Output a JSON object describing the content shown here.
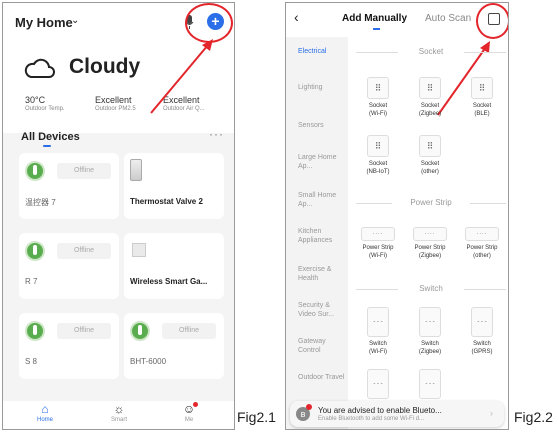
{
  "left_phone": {
    "home_title": "My Home",
    "weather": "Cloudy",
    "stats": [
      {
        "value": "30°C",
        "label": "Outdoor Temp."
      },
      {
        "value": "Excellent",
        "label": "Outdoor PM2.5"
      },
      {
        "value": "Excellent",
        "label": "Outdoor Air Q..."
      }
    ],
    "all_devices": "All Devices",
    "devices": [
      {
        "name": "温控器 7",
        "status": "Offline"
      },
      {
        "name": "Thermostat Valve 2",
        "status": ""
      },
      {
        "name": "R 7",
        "status": "Offline"
      },
      {
        "name": "Wireless Smart Ga...",
        "status": ""
      },
      {
        "name": "S 8",
        "status": "Offline"
      },
      {
        "name": "BHT-6000",
        "status": "Offline"
      }
    ],
    "tabs": [
      "Home",
      "Smart",
      "Me"
    ]
  },
  "right_phone": {
    "tabs": [
      "Add Manually",
      "Auto Scan"
    ],
    "sidebar": [
      "Electrical",
      "Lighting",
      "Sensors",
      "Large Home Ap...",
      "Small Home Ap...",
      "Kitchen Appliances",
      "Exercise & Health",
      "Security & Video Sur...",
      "Gateway Control",
      "Outdoor Travel"
    ],
    "sections": [
      "Socket",
      "Power Strip",
      "Switch"
    ],
    "sockets": [
      [
        "Socket",
        "(Wi-Fi)"
      ],
      [
        "Socket",
        "(Zigbee)"
      ],
      [
        "Socket",
        "(BLE)"
      ],
      [
        "Socket",
        "(NB-IoT)"
      ],
      [
        "Socket",
        "(other)"
      ]
    ],
    "strips": [
      [
        "Power Strip",
        "(Wi-Fi)"
      ],
      [
        "Power Strip",
        "(Zigbee)"
      ],
      [
        "Power Strip",
        "(other)"
      ]
    ],
    "switches": [
      [
        "Switch",
        "(Wi-Fi)"
      ],
      [
        "Switch",
        "(Zigbee)"
      ],
      [
        "Switch",
        "(GPRS)"
      ]
    ],
    "banner_title": "You are advised to enable Blueto...",
    "banner_sub": "Enable Bluetooth to add some Wi-Fi d..."
  },
  "fig_labels": [
    "Fig2.1",
    "Fig2.2"
  ],
  "colors": {
    "accent": "#2b6ee8",
    "highlight": "#e3262b",
    "device_green": "#5aad4e"
  }
}
